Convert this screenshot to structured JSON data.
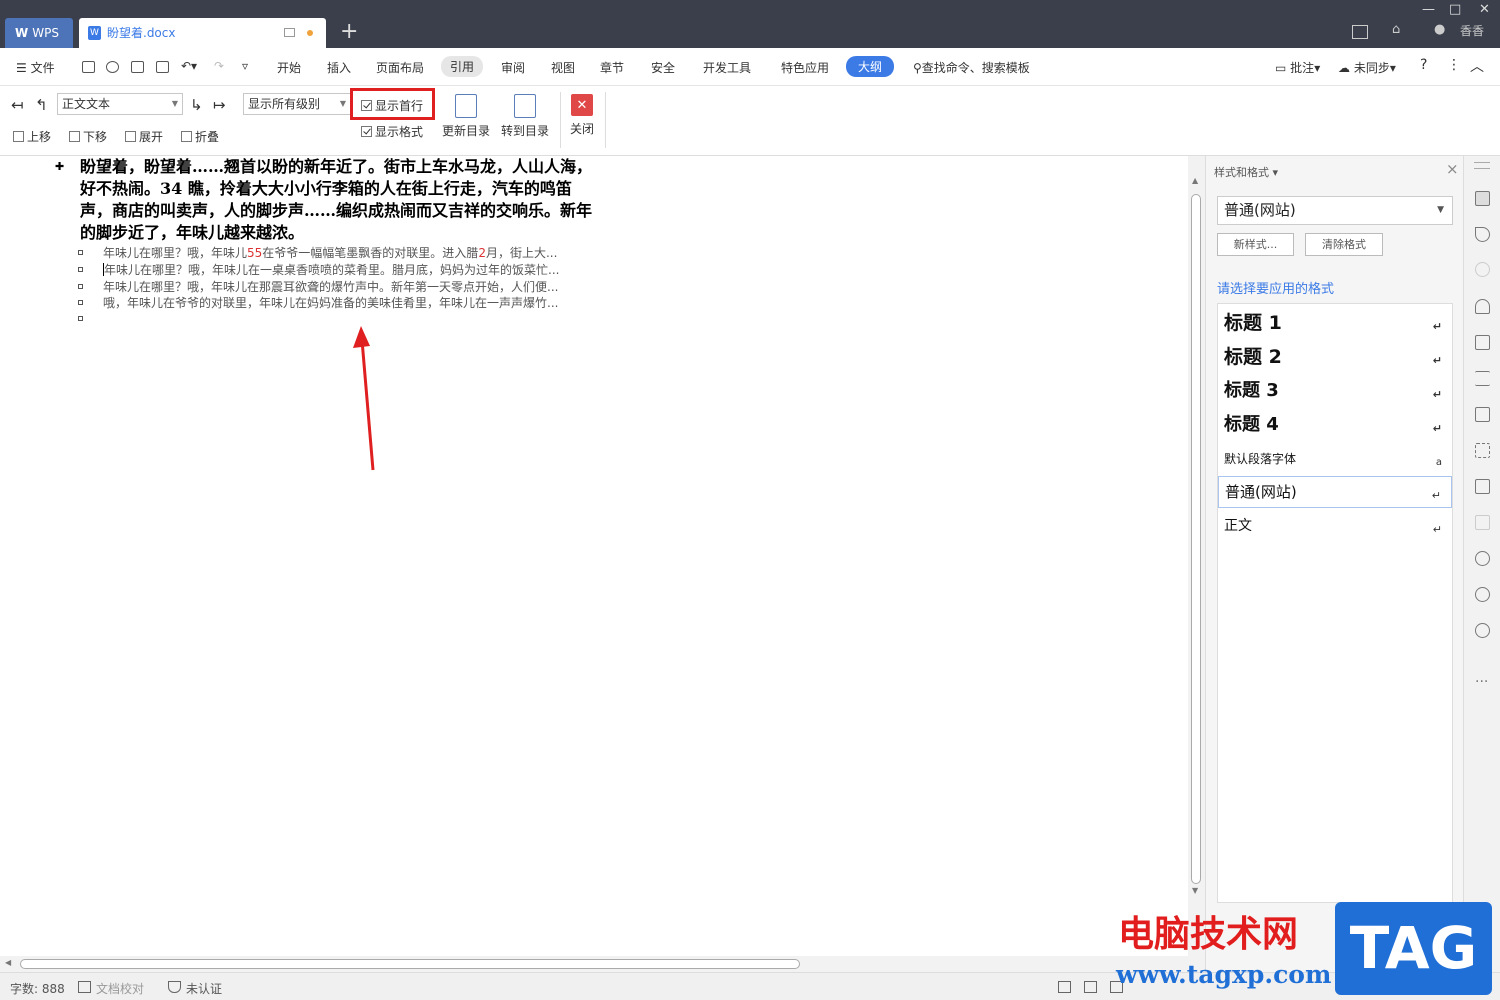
{
  "titlebar": {
    "app_tab": "WPS",
    "doc_tab": "盼望着.docx",
    "user": "香香"
  },
  "menubar": {
    "file": "文件",
    "items": [
      "开始",
      "插入",
      "页面布局",
      "引用",
      "审阅",
      "视图",
      "章节",
      "安全",
      "开发工具",
      "特色应用",
      "大纲"
    ],
    "search": "查找命令、搜索模板",
    "comment": "批注",
    "sync": "未同步"
  },
  "ribbon": {
    "level_combo": "正文文本",
    "move_up": "上移",
    "move_down": "下移",
    "expand": "展开",
    "collapse": "折叠",
    "show_levels": "显示所有级别",
    "show_first_line": "显示首行",
    "show_format": "显示格式",
    "update_toc": "更新目录",
    "goto_toc": "转到目录",
    "close": "关闭"
  },
  "document": {
    "heading": "盼望着，盼望着……翘首以盼的新年近了。街市上车水马龙，人山人海，好不热闹。34 瞧，拎着大大小小行李箱的人在街上行走，汽车的鸣笛声，商店的叫卖声，人的脚步声……编织成热闹而又吉祥的交响乐。新年的脚步近了，年味儿越来越浓。",
    "line1_a": "年味儿在哪里？哦，年味儿",
    "line1_num1": "55",
    "line1_b": "在爷爷一幅幅笔墨飘香的对联里。进入腊",
    "line1_num2": "2",
    "line1_c": "月，街上大...",
    "line2": "年味儿在哪里？哦，年味儿在一桌桌香喷喷的菜肴里。腊月底，妈妈为过年的饭菜忙...",
    "line3": "年味儿在哪里？哦，年味儿在那震耳欲聋的爆竹声中。新年第一天零点开始，人们便...",
    "line4": "哦，年味儿在爷爷的对联里，年味儿在妈妈准备的美味佳肴里，年味儿在一声声爆竹..."
  },
  "panel": {
    "title": "样式和格式",
    "current_style": "普通(网站)",
    "new_style": "新样式...",
    "clear_format": "清除格式",
    "apply_prompt": "请选择要应用的格式",
    "styles": [
      "标题 1",
      "标题 2",
      "标题 3",
      "标题 4",
      "默认段落字体",
      "普通(网站)",
      "正文"
    ]
  },
  "statusbar": {
    "word_count": "字数: 888",
    "proofread": "文档校对",
    "unverified": "未认证"
  },
  "watermark": {
    "cn": "电脑技术网",
    "url": "www.tagxp.com",
    "tag": "TAG"
  },
  "colors": {
    "accent": "#3c7be6",
    "title_bar": "#3a3f4b",
    "highlight": "#e02020"
  }
}
